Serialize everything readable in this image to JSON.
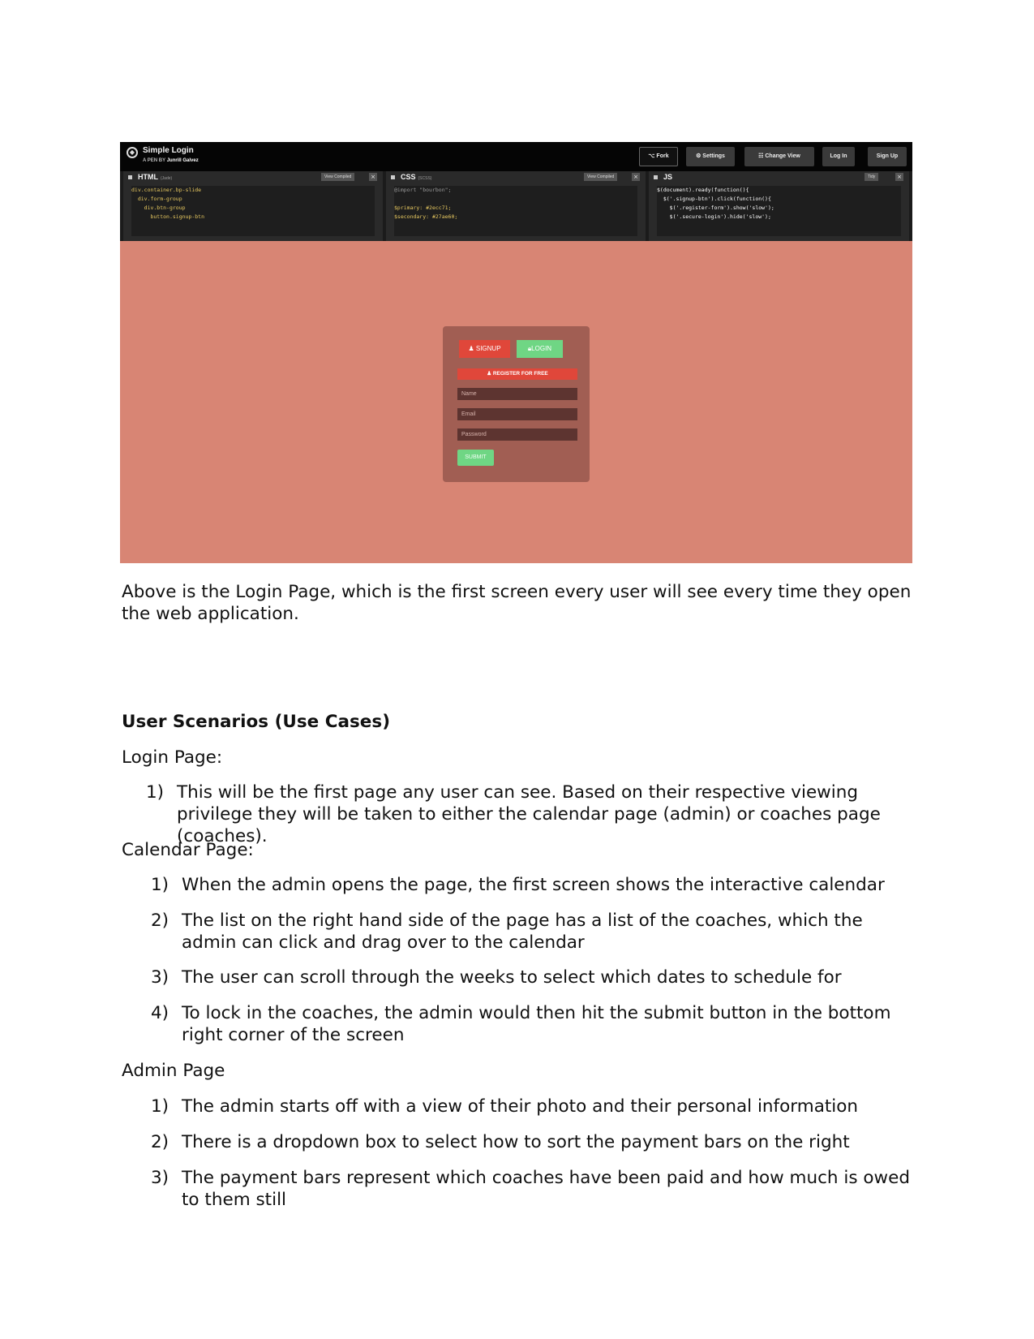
{
  "screenshot": {
    "topbar": {
      "title": "Simple Login",
      "author_prefix": "A PEN BY",
      "author": "Junrill Galvez",
      "buttons": [
        "⌥ Fork",
        "⚙ Settings",
        "☷ Change View",
        "Log In",
        "Sign Up"
      ]
    },
    "panes": [
      {
        "name": "HTML",
        "sub": "(Jade)",
        "button": "View Compiled",
        "lines": [
          "div.container.bp-slide",
          "  div.form-group",
          "    div.btn-group",
          "      button.signup-btn"
        ]
      },
      {
        "name": "CSS",
        "sub": "(SCSS)",
        "button": "View Compiled",
        "lines": [
          "@import \"bourbon\";",
          "",
          "$primary: #2ecc71;",
          "$secondary: #27ae60;"
        ]
      },
      {
        "name": "JS",
        "sub": "",
        "button": "Tidy",
        "lines": [
          "$(document).ready(function(){",
          "  $('.signup-btn').click(function(){",
          "    $('.register-form').show('slow');",
          "    $('.secure-login').hide('slow');"
        ]
      }
    ],
    "login": {
      "signup": "SIGNUP",
      "login": "LOGIN",
      "register": "REGISTER FOR FREE",
      "name_placeholder": "Name",
      "email_placeholder": "Email",
      "password_placeholder": "Password",
      "submit": "SUBMIT"
    },
    "colors": {
      "background": "#d88574",
      "box": "#a15e53",
      "red_button": "#e0473a",
      "green_button": "#6fd684"
    }
  },
  "document": {
    "caption": "Above is the Login Page, which is the first screen every user will see every time they open the web application.",
    "heading": "User Scenarios (Use Cases)",
    "login_section": {
      "title": "Login Page:",
      "items": [
        {
          "num": "1)",
          "text": "This will be the first page any user can see. Based on their respective viewing privilege they will be taken to either the calendar page (admin) or coaches page (coaches)."
        }
      ]
    },
    "calendar_section": {
      "title": "Calendar Page:",
      "items": [
        {
          "num": "1)",
          "text": "When the admin opens the page, the first screen shows the interactive calendar"
        },
        {
          "num": "2)",
          "text": "The list on the right hand side of the  page has a list of the coaches, which the admin can click and drag over to the calendar"
        },
        {
          "num": "3)",
          "text": "The user can scroll through the weeks to select which dates to schedule for"
        },
        {
          "num": "4)",
          "text": "To lock in the coaches, the admin would then hit the submit button in the bottom right corner of the screen"
        }
      ]
    },
    "admin_section": {
      "title": "Admin Page",
      "items": [
        {
          "num": "1)",
          "text": "The admin starts off with a view of their photo and their personal information"
        },
        {
          "num": "2)",
          "text": "There is a dropdown box to select how to sort the payment bars on the right"
        },
        {
          "num": "3)",
          "text": "The payment bars represent which coaches have been paid and how much is owed to them still"
        }
      ]
    }
  }
}
